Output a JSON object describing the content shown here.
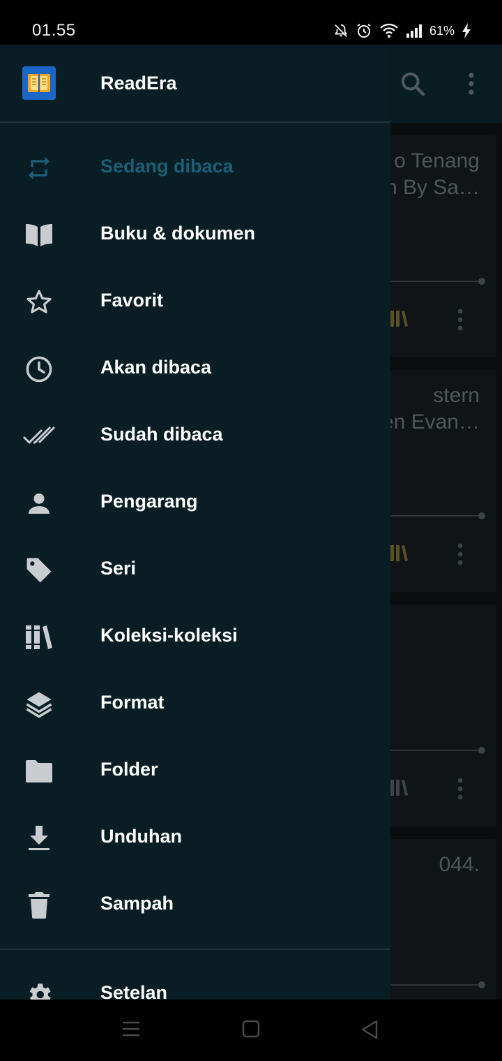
{
  "status_bar": {
    "time": "01.55",
    "battery": "61%",
    "icons": [
      "mute-icon",
      "alarm-icon",
      "wifi-icon",
      "signal-icon",
      "charging-icon"
    ]
  },
  "background": {
    "cards": [
      {
        "title": "o Tenang\nn By Sa…"
      },
      {
        "title": "stern\nen Evan…"
      },
      {
        "title": ""
      },
      {
        "title": "044."
      }
    ],
    "toolbar_icons": [
      "search-icon",
      "more-vert-icon"
    ]
  },
  "drawer": {
    "app_name": "ReadEra",
    "items": [
      {
        "label": "Sedang dibaca",
        "icon": "repeat-icon",
        "active": true
      },
      {
        "label": "Buku & dokumen",
        "icon": "book-open-icon"
      },
      {
        "label": "Favorit",
        "icon": "star-outline-icon"
      },
      {
        "label": "Akan dibaca",
        "icon": "clock-icon"
      },
      {
        "label": "Sudah dibaca",
        "icon": "double-check-icon"
      },
      {
        "label": "Pengarang",
        "icon": "person-icon"
      },
      {
        "label": "Seri",
        "icon": "tag-icon"
      },
      {
        "label": "Koleksi-koleksi",
        "icon": "library-icon"
      },
      {
        "label": "Format",
        "icon": "layers-icon"
      },
      {
        "label": "Folder",
        "icon": "folder-icon"
      },
      {
        "label": "Unduhan",
        "icon": "download-icon"
      },
      {
        "label": "Sampah",
        "icon": "trash-icon"
      }
    ],
    "settings_label": "Setelan"
  },
  "colors": {
    "drawer_bg": "#081d24",
    "active_text": "#1b5f78",
    "icon": "#c9cdd0",
    "toolbar": "#0d2d35"
  }
}
